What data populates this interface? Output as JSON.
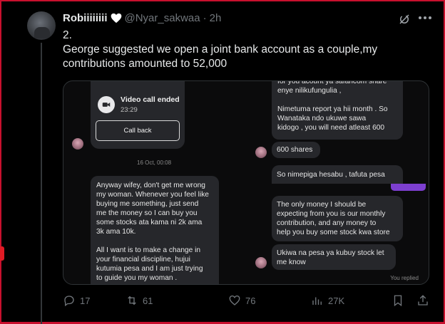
{
  "tweet": {
    "display_name": "Robiiiiiiii",
    "handle": "@Nyar_sakwaa",
    "separator": "·",
    "time": "2h",
    "text_lines": [
      "2.",
      "George suggested we open a joint bank account as a couple,my",
      "contributions amounted to 52,000"
    ]
  },
  "screenshot": {
    "call_card": {
      "title": "Video call ended",
      "time": "23:29",
      "button": "Call back"
    },
    "date_separator": "16 Oct, 00:08",
    "left_message": [
      "Anyway wifey, don't get me wrong",
      "my woman. Whenever you feel like",
      "buying me something,  just send",
      "me the money so I can buy you",
      "some stocks ata kama ni 2k ama",
      "3k ama 10k.",
      "",
      "All I want is to make a change in",
      "your financial discipline,  hujui",
      "kutumia pesa and I am just trying",
      "to guide you my woman ."
    ],
    "right_messages": [
      {
        "lines": [
          "for you acount ya safaricom share",
          "enye nilikufungulia ,",
          "",
          "Nimetuma report ya hii month . So",
          "Wanataka ndo ukuwe sawa",
          "kidogo , you will need atleast 600"
        ]
      },
      {
        "lines": [
          "600 shares"
        ]
      },
      {
        "lines": [
          "So nimepiga hesabu , tafuta pesa"
        ]
      },
      {
        "lines": [
          "The only money I should be",
          "expecting from you is  our monthly",
          "contribution,  and  any money to",
          "help you buy some stock kwa store"
        ]
      },
      {
        "lines": [
          "Ukiwa na pesa ya kubuy stock let",
          "me know"
        ]
      }
    ],
    "you_replied": "You replied"
  },
  "actions": {
    "replies": "17",
    "reposts": "61",
    "likes": "76",
    "views": "27K"
  },
  "colors": {
    "frame": "#c8102e",
    "muted": "#71767b",
    "bubble": "#26272b",
    "accent_tab": "#7d3fd0"
  },
  "icons": [
    "heart-icon",
    "grok-icon",
    "more-icon",
    "video-camera-icon",
    "reply-icon",
    "repost-icon",
    "like-icon",
    "views-icon",
    "bookmark-icon",
    "share-icon"
  ]
}
